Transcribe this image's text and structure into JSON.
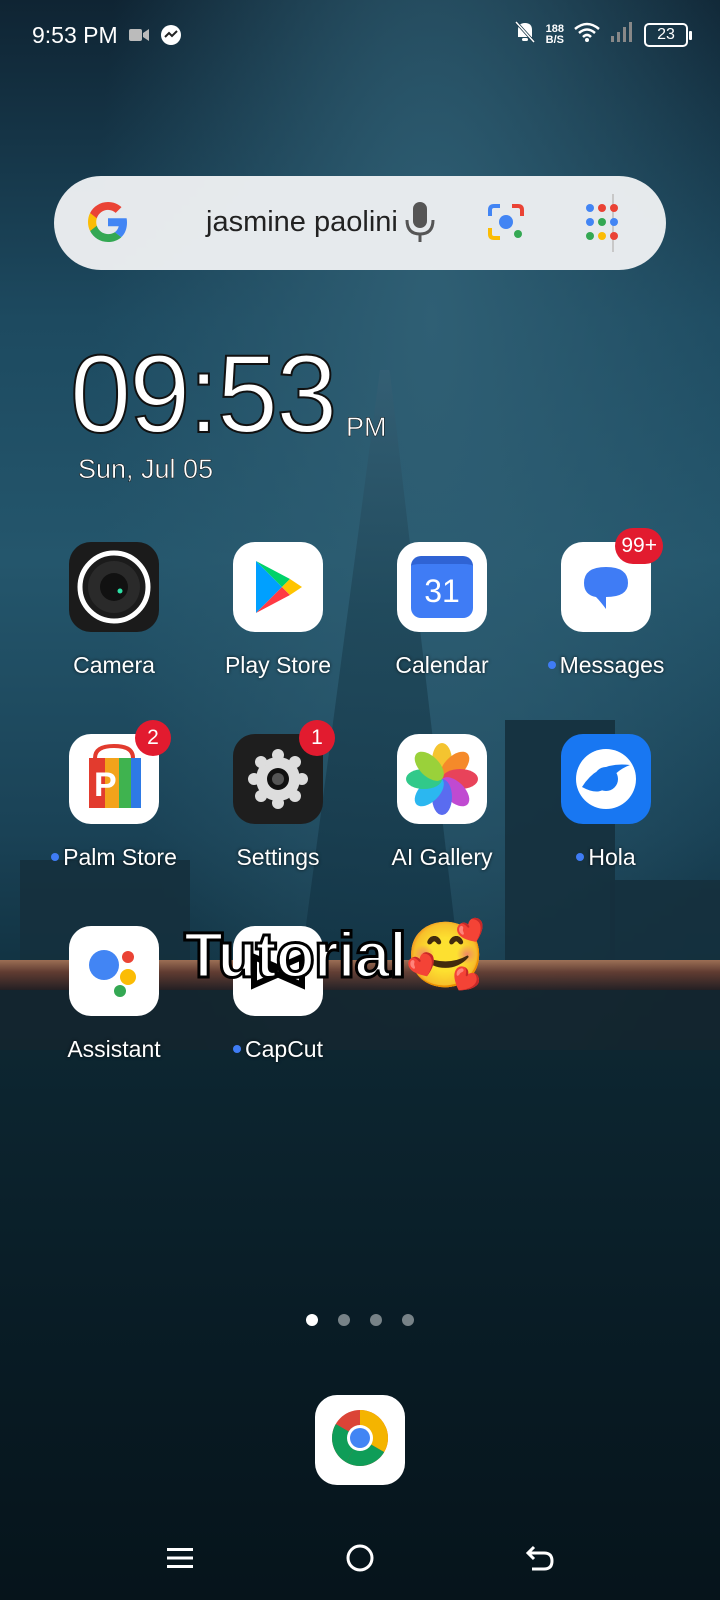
{
  "status_bar": {
    "time": "9:53 PM",
    "net_speed_value": "188",
    "net_speed_unit": "B/S",
    "battery": "23",
    "icons": [
      "video-icon",
      "messenger-icon",
      "mute-bell-icon",
      "wifi-icon",
      "signal-icon",
      "battery-icon"
    ]
  },
  "search": {
    "query": "jasmine paolini",
    "icons": [
      "google-logo",
      "mic-icon",
      "lens-icon",
      "apps-icon"
    ]
  },
  "clock": {
    "time": "09:53",
    "ampm": "PM",
    "date": "Sun, Jul 05"
  },
  "apps": [
    {
      "label": "Camera",
      "badge": ""
    },
    {
      "label": "Play Store",
      "badge": ""
    },
    {
      "label": "Calendar",
      "badge": "",
      "icon_text": "31"
    },
    {
      "label": "Messages",
      "badge": "99+"
    },
    {
      "label": "Palm Store",
      "badge": "2"
    },
    {
      "label": "Settings",
      "badge": "1"
    },
    {
      "label": "AI Gallery",
      "badge": ""
    },
    {
      "label": "Hola",
      "badge": ""
    },
    {
      "label": "Assistant",
      "badge": ""
    },
    {
      "label": "CapCut",
      "badge": ""
    }
  ],
  "overlay": {
    "text": "Tutorial🥰"
  },
  "page_indicator": {
    "count": 4,
    "active": 0
  },
  "dock": {
    "apps": [
      "chrome-icon"
    ]
  },
  "nav_bar": {
    "buttons": [
      "menu-button",
      "home-button",
      "back-button"
    ]
  }
}
